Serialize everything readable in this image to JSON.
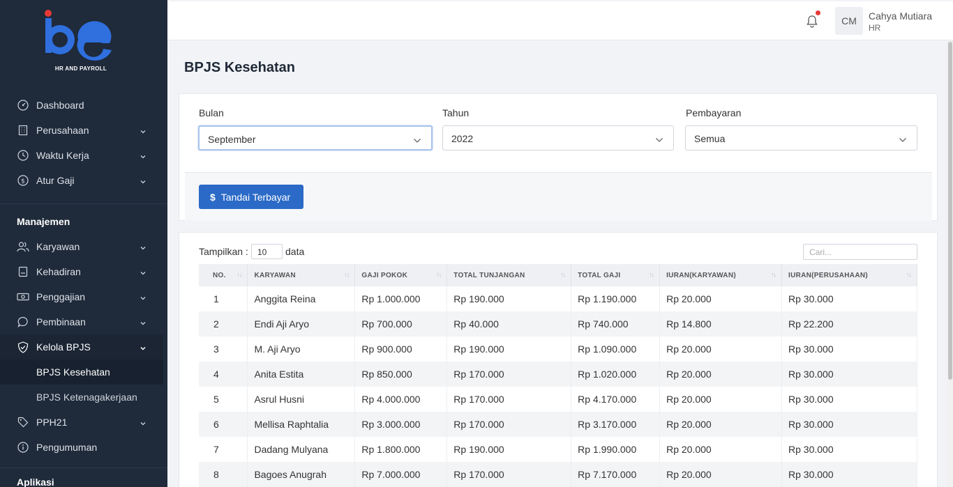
{
  "brand": {
    "logo_text": "be",
    "tagline": "HR AND PAYROLL",
    "colors": {
      "blue": "#2f6fde",
      "red": "#e53935"
    }
  },
  "sidebar": {
    "items": [
      {
        "label": "Dashboard",
        "icon": "dashboard-icon",
        "has_chevron": false
      },
      {
        "label": "Perusahaan",
        "icon": "building-icon",
        "has_chevron": true
      },
      {
        "label": "Waktu Kerja",
        "icon": "clock-icon",
        "has_chevron": true
      },
      {
        "label": "Atur Gaji",
        "icon": "dollar-circle-icon",
        "has_chevron": true
      }
    ],
    "section_management": "Manajemen",
    "management_items": [
      {
        "label": "Karyawan",
        "icon": "users-icon"
      },
      {
        "label": "Kehadiran",
        "icon": "clipboard-icon"
      },
      {
        "label": "Penggajian",
        "icon": "cash-icon"
      },
      {
        "label": "Pembinaan",
        "icon": "chat-icon"
      },
      {
        "label": "Kelola BPJS",
        "icon": "shield-icon"
      }
    ],
    "bpjs_sub": [
      "BPJS Kesehatan",
      "BPJS Ketenagakerjaan"
    ],
    "after_items": [
      {
        "label": "PPH21",
        "icon": "tag-icon",
        "has_chevron": true
      },
      {
        "label": "Pengumuman",
        "icon": "info-icon",
        "has_chevron": false
      }
    ],
    "section_apps": "Aplikasi"
  },
  "header": {
    "avatar_initials": "CM",
    "user_name": "Cahya Mutiara",
    "user_role": "HR"
  },
  "page": {
    "title": "BPJS Kesehatan"
  },
  "filters": {
    "month_label": "Bulan",
    "month_value": "September",
    "year_label": "Tahun",
    "year_value": "2022",
    "payment_label": "Pembayaran",
    "payment_value": "Semua",
    "mark_paid_button": "Tandai Terbayar"
  },
  "table": {
    "show_label": "Tampilkan :",
    "show_value": "10",
    "show_suffix": "data",
    "search_placeholder": "Cari...",
    "columns": [
      "NO.",
      "KARYAWAN",
      "GAJI POKOK",
      "TOTAL TUNJANGAN",
      "TOTAL GAJI",
      "IURAN(KARYAWAN)",
      "IURAN(PERUSAHAAN)"
    ],
    "rows": [
      [
        "1",
        "Anggita Reina",
        "Rp 1.000.000",
        "Rp 190.000",
        "Rp 1.190.000",
        "Rp 20.000",
        "Rp 30.000"
      ],
      [
        "2",
        "Endi Aji Aryo",
        "Rp 700.000",
        "Rp 40.000",
        "Rp 740.000",
        "Rp 14.800",
        "Rp 22.200"
      ],
      [
        "3",
        "M. Aji Aryo",
        "Rp 900.000",
        "Rp 190.000",
        "Rp 1.090.000",
        "Rp 20.000",
        "Rp 30.000"
      ],
      [
        "4",
        "Anita Estita",
        "Rp 850.000",
        "Rp 170.000",
        "Rp 1.020.000",
        "Rp 20.000",
        "Rp 30.000"
      ],
      [
        "5",
        "Asrul Husni",
        "Rp 4.000.000",
        "Rp 170.000",
        "Rp 4.170.000",
        "Rp 20.000",
        "Rp 30.000"
      ],
      [
        "6",
        "Mellisa Raphtalia",
        "Rp 3.000.000",
        "Rp 170.000",
        "Rp 3.170.000",
        "Rp 20.000",
        "Rp 30.000"
      ],
      [
        "7",
        "Dadang Mulyana",
        "Rp 1.800.000",
        "Rp 190.000",
        "Rp 1.990.000",
        "Rp 20.000",
        "Rp 30.000"
      ],
      [
        "8",
        "Bagoes Anugrah",
        "Rp 7.000.000",
        "Rp 170.000",
        "Rp 7.170.000",
        "Rp 20.000",
        "Rp 30.000"
      ]
    ]
  }
}
